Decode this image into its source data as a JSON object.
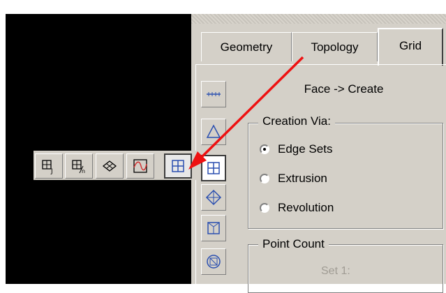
{
  "tabs": [
    {
      "label": "Geometry"
    },
    {
      "label": "Topology"
    },
    {
      "label": "Grid"
    }
  ],
  "pane_title": "Face -> Create",
  "creation_group": {
    "legend": "Creation Via:",
    "options": [
      {
        "label": "Edge Sets",
        "selected": true
      },
      {
        "label": "Extrusion",
        "selected": false
      },
      {
        "label": "Revolution",
        "selected": false
      }
    ]
  },
  "point_group": {
    "legend": "Point Count",
    "set_label": "Set 1:"
  },
  "side_toolbar": [
    "vertex-icon",
    "edge-icon",
    "face-icon",
    "volume-icon",
    "block-icon",
    "mesh-icon"
  ],
  "popup_toolbar": [
    "face-j-icon",
    "face-n-icon",
    "face-diamond-icon",
    "face-wave-icon",
    "face-grid-icon"
  ],
  "colors": {
    "arrow": "#ee1111",
    "panel": "#d4d0c8",
    "viewport": "#000000"
  }
}
